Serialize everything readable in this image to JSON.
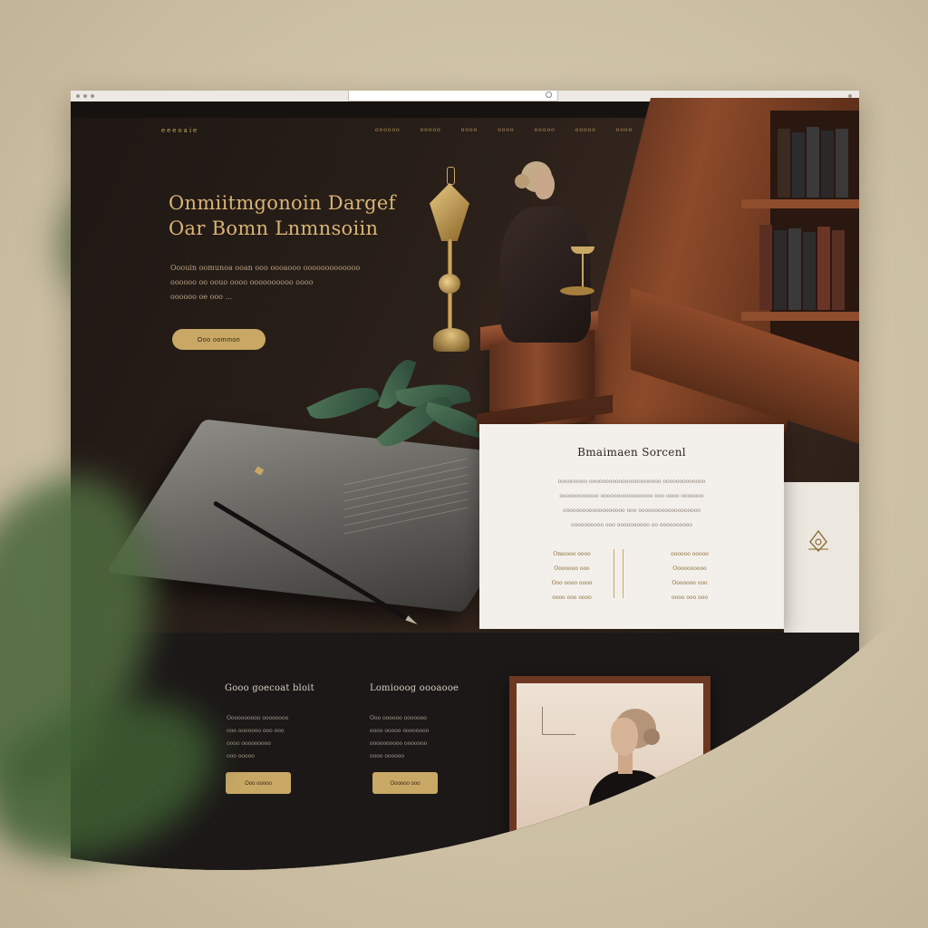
{
  "brand": {
    "logo": "eeeoaie"
  },
  "nav": {
    "items": [
      "oooooo",
      "ooooo",
      "oooo",
      "oooo",
      "ooooo",
      "ooooo",
      "oooo",
      "ooo"
    ]
  },
  "hero": {
    "title_line1": "Onmiitmgonoin Dargef",
    "title_line2": "Oar Bomn Lnmnsoiin",
    "subtitle_line1": "Ooouin oomunoa ooan ooo oooaooo ooooooooooooo",
    "subtitle_line2": "oooooo oo oouo oooo oooooooooo oooo",
    "subtitle_line3": "oooooo oe ooo ...",
    "cta_label": "Ooo oommon"
  },
  "card": {
    "title": "Bmaimaen Sorcenl",
    "body_line1": "ooooooooo oooooooooooooooooooooo ooooooooooooo",
    "body_line2": "oooooooooooo oooooooooooooooo ooo oooo ooooooo",
    "body_line3": "ooooooooooooooooooo ooo ooooooooooooooooooo",
    "body_line4": "oooooooooo ooo oooooooooo oo oooooooooo",
    "left_col": [
      "Omoooo oooo",
      "Ooooooo ooo",
      "Ooo oooo oooo",
      "oooo ooo oooo"
    ],
    "right_col": [
      "oooooo ooooo",
      "Oooooooooo",
      "Ooooooo ooo",
      "oooo ooo ooo"
    ]
  },
  "lower": {
    "col1": {
      "title": "Gooo goecoat bloit",
      "text": [
        "Oooooooooo oooooooo",
        "ooo ooooooo ooo ooo",
        "oooo ooooooooo",
        "ooo ooooo"
      ],
      "button": "Ooo ooooo"
    },
    "col2": {
      "title": "Lomiooog oooaooe",
      "text": [
        "Ooo oooooo ooooooo",
        "oooo ooooo oooooooo",
        "oooooooooo ooooooo",
        "oooo oooooo"
      ],
      "button": "Oooooo ooo"
    }
  },
  "colors": {
    "accent_gold": "#c9a865",
    "hero_dark": "#1e1713",
    "card_bg": "#f3f0ec",
    "lower_bg": "#1b1817"
  },
  "icons": [
    "lock-icon",
    "ornament-icon"
  ]
}
